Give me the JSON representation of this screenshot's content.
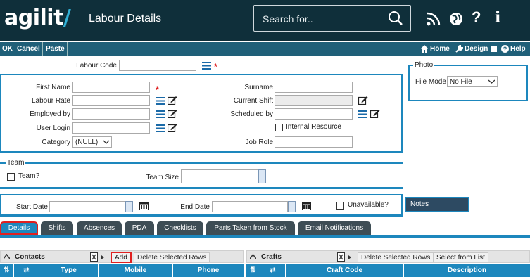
{
  "header": {
    "logo_text": "agilit",
    "logo_mark": "/",
    "title": "Labour Details",
    "search_placeholder": "Search for..",
    "icons": [
      "rss-icon",
      "globe-icon",
      "help-icon",
      "info-icon"
    ]
  },
  "toolbar": {
    "ok": "OK",
    "cancel": "Cancel",
    "paste": "Paste",
    "home": "Home",
    "design": "Design",
    "help": "Help"
  },
  "form": {
    "labour_code": "Labour Code",
    "first_name": "First Name",
    "labour_rate": "Labour Rate",
    "employed_by": "Employed by",
    "user_login": "User Login",
    "category": "Category",
    "category_value": "(NULL)",
    "surname": "Surname",
    "current_shift": "Current Shift",
    "scheduled_by": "Scheduled by",
    "internal_resource": "Internal Resource",
    "job_role": "Job Role",
    "required_mark": "*"
  },
  "photo": {
    "title": "Photo",
    "file_mode_label": "File Mode",
    "file_mode_value": "No File"
  },
  "team": {
    "title": "Team",
    "team_q": "Team?",
    "team_size": "Team Size"
  },
  "dates": {
    "start_date": "Start Date",
    "end_date": "End Date",
    "unavailable": "Unavailable?",
    "notes": "Notes"
  },
  "tabs": [
    "Details",
    "Shifts",
    "Absences",
    "PDA",
    "Checklists",
    "Parts Taken from Stock",
    "Email Notifications"
  ],
  "contacts": {
    "title": "Contacts",
    "add": "Add",
    "delete": "Delete Selected Rows",
    "columns": [
      "Type",
      "Mobile",
      "Phone"
    ]
  },
  "crafts": {
    "title": "Crafts",
    "delete": "Delete Selected Rows",
    "select": "Select from List",
    "columns": [
      "Craft Code",
      "Description"
    ]
  },
  "colors": {
    "header_bg": "#0f2f3a",
    "toolbar_bg": "#1f5f78",
    "accent": "#1d87bd",
    "highlight": "#e02020",
    "tab_bg": "#3e4d55"
  }
}
